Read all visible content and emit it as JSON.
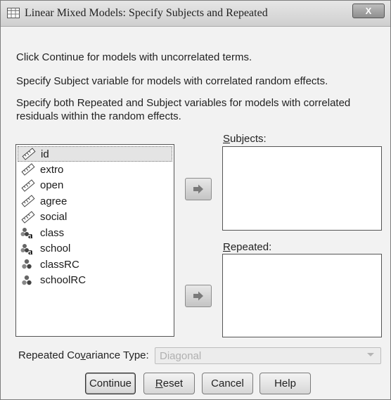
{
  "window": {
    "title": "Linear Mixed Models: Specify Subjects and Repeated",
    "close_label": "X"
  },
  "instructions": {
    "line1": "Click Continue for models with uncorrelated terms.",
    "line2": "Specify Subject variable for models with correlated random effects.",
    "line3a": "Specify both Repeated and Subject variables for models with correlated",
    "line3b": "residuals within the random effects."
  },
  "variables": [
    {
      "name": "id",
      "icon": "scale-ruler-icon",
      "selected": true
    },
    {
      "name": "extro",
      "icon": "scale-ruler-icon"
    },
    {
      "name": "open",
      "icon": "scale-ruler-icon"
    },
    {
      "name": "agree",
      "icon": "scale-ruler-icon"
    },
    {
      "name": "social",
      "icon": "scale-ruler-icon"
    },
    {
      "name": "class",
      "icon": "nominal-string-icon"
    },
    {
      "name": "school",
      "icon": "nominal-string-icon"
    },
    {
      "name": "classRC",
      "icon": "nominal-icon"
    },
    {
      "name": "schoolRC",
      "icon": "nominal-icon"
    }
  ],
  "subjects": {
    "label_pre": "",
    "label_ul": "S",
    "label_post": "ubjects:"
  },
  "repeated": {
    "label_pre": "",
    "label_ul": "R",
    "label_post": "epeated:"
  },
  "covariance": {
    "label_pre": "Repeated Co",
    "label_ul": "v",
    "label_post": "ariance Type:",
    "value": "Diagonal"
  },
  "buttons": {
    "continue": "Continue",
    "reset_ul": "R",
    "reset_rest": "eset",
    "cancel": "Cancel",
    "help": "Help"
  },
  "colors": {
    "window_bg": "#f2f2f2",
    "list_bg": "#ffffff",
    "disabled_text": "#b0b0b0"
  }
}
